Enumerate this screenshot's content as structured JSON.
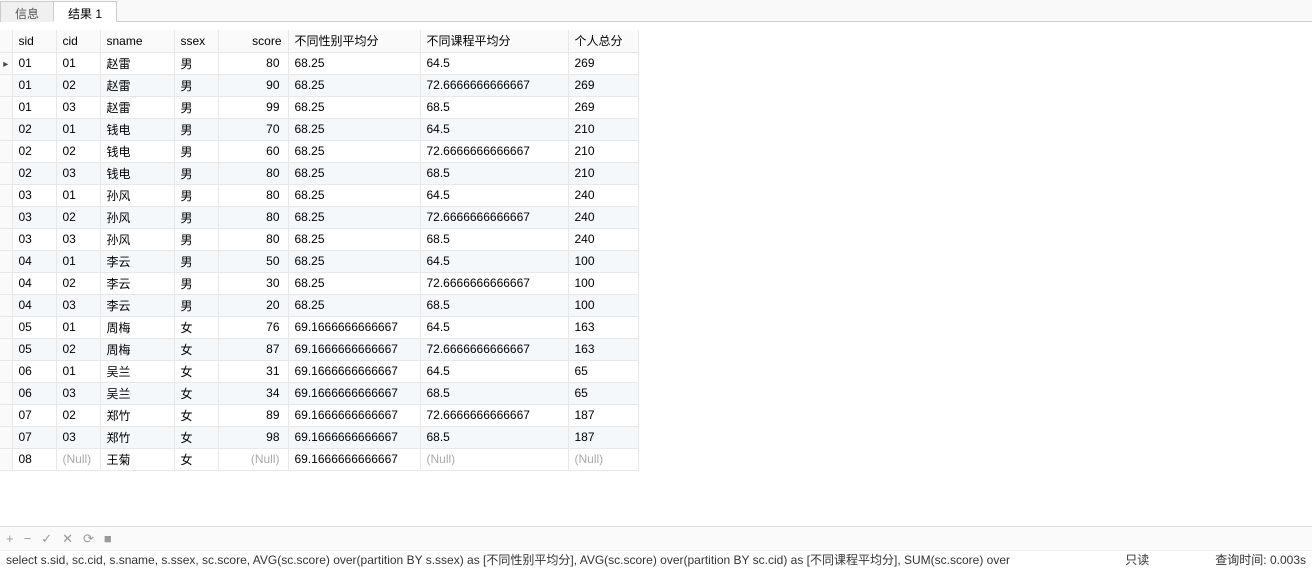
{
  "tabs": {
    "info": "信息",
    "result": "结果 1"
  },
  "columns": [
    "sid",
    "cid",
    "sname",
    "ssex",
    "score",
    "不同性别平均分",
    "不同课程平均分",
    "个人总分"
  ],
  "null_text": "(Null)",
  "rows": [
    {
      "sid": "01",
      "cid": "01",
      "sname": "赵雷",
      "ssex": "男",
      "score": "80",
      "sexavg": "68.25",
      "cidavg": "64.5",
      "total": "269",
      "current": true
    },
    {
      "sid": "01",
      "cid": "02",
      "sname": "赵雷",
      "ssex": "男",
      "score": "90",
      "sexavg": "68.25",
      "cidavg": "72.6666666666667",
      "total": "269"
    },
    {
      "sid": "01",
      "cid": "03",
      "sname": "赵雷",
      "ssex": "男",
      "score": "99",
      "sexavg": "68.25",
      "cidavg": "68.5",
      "total": "269"
    },
    {
      "sid": "02",
      "cid": "01",
      "sname": "钱电",
      "ssex": "男",
      "score": "70",
      "sexavg": "68.25",
      "cidavg": "64.5",
      "total": "210"
    },
    {
      "sid": "02",
      "cid": "02",
      "sname": "钱电",
      "ssex": "男",
      "score": "60",
      "sexavg": "68.25",
      "cidavg": "72.6666666666667",
      "total": "210"
    },
    {
      "sid": "02",
      "cid": "03",
      "sname": "钱电",
      "ssex": "男",
      "score": "80",
      "sexavg": "68.25",
      "cidavg": "68.5",
      "total": "210"
    },
    {
      "sid": "03",
      "cid": "01",
      "sname": "孙风",
      "ssex": "男",
      "score": "80",
      "sexavg": "68.25",
      "cidavg": "64.5",
      "total": "240"
    },
    {
      "sid": "03",
      "cid": "02",
      "sname": "孙风",
      "ssex": "男",
      "score": "80",
      "sexavg": "68.25",
      "cidavg": "72.6666666666667",
      "total": "240"
    },
    {
      "sid": "03",
      "cid": "03",
      "sname": "孙风",
      "ssex": "男",
      "score": "80",
      "sexavg": "68.25",
      "cidavg": "68.5",
      "total": "240"
    },
    {
      "sid": "04",
      "cid": "01",
      "sname": "李云",
      "ssex": "男",
      "score": "50",
      "sexavg": "68.25",
      "cidavg": "64.5",
      "total": "100"
    },
    {
      "sid": "04",
      "cid": "02",
      "sname": "李云",
      "ssex": "男",
      "score": "30",
      "sexavg": "68.25",
      "cidavg": "72.6666666666667",
      "total": "100"
    },
    {
      "sid": "04",
      "cid": "03",
      "sname": "李云",
      "ssex": "男",
      "score": "20",
      "sexavg": "68.25",
      "cidavg": "68.5",
      "total": "100"
    },
    {
      "sid": "05",
      "cid": "01",
      "sname": "周梅",
      "ssex": "女",
      "score": "76",
      "sexavg": "69.1666666666667",
      "cidavg": "64.5",
      "total": "163"
    },
    {
      "sid": "05",
      "cid": "02",
      "sname": "周梅",
      "ssex": "女",
      "score": "87",
      "sexavg": "69.1666666666667",
      "cidavg": "72.6666666666667",
      "total": "163"
    },
    {
      "sid": "06",
      "cid": "01",
      "sname": "吴兰",
      "ssex": "女",
      "score": "31",
      "sexavg": "69.1666666666667",
      "cidavg": "64.5",
      "total": "65"
    },
    {
      "sid": "06",
      "cid": "03",
      "sname": "吴兰",
      "ssex": "女",
      "score": "34",
      "sexavg": "69.1666666666667",
      "cidavg": "68.5",
      "total": "65"
    },
    {
      "sid": "07",
      "cid": "02",
      "sname": "郑竹",
      "ssex": "女",
      "score": "89",
      "sexavg": "69.1666666666667",
      "cidavg": "72.6666666666667",
      "total": "187"
    },
    {
      "sid": "07",
      "cid": "03",
      "sname": "郑竹",
      "ssex": "女",
      "score": "98",
      "sexavg": "69.1666666666667",
      "cidavg": "68.5",
      "total": "187"
    },
    {
      "sid": "08",
      "cid": null,
      "sname": "王菊",
      "ssex": "女",
      "score": null,
      "sexavg": "69.1666666666667",
      "cidavg": null,
      "total": null
    }
  ],
  "toolbar": {
    "add": "+",
    "remove": "−",
    "apply": "✓",
    "cancel": "✕",
    "refresh": "⟳",
    "stop": "■"
  },
  "status": {
    "sql": "select   s.sid,   sc.cid,   s.sname,   s.ssex,   sc.score,   AVG(sc.score) over(partition BY s.ssex) as [不同性别平均分],   AVG(sc.score) over(partition BY sc.cid) as [不同课程平均分],   SUM(sc.score) over",
    "readonly": "只读",
    "timing": "查询时间: 0.003s"
  }
}
